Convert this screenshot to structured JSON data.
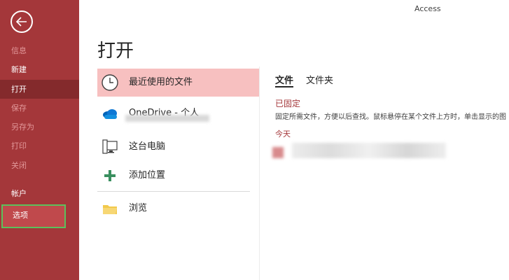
{
  "app": {
    "name": "Access"
  },
  "page": {
    "title": "打开"
  },
  "sidebar": {
    "items": [
      {
        "label": "信息",
        "state": "disabled"
      },
      {
        "label": "新建",
        "state": "normal"
      },
      {
        "label": "打开",
        "state": "active"
      },
      {
        "label": "保存",
        "state": "disabled"
      },
      {
        "label": "另存为",
        "state": "disabled"
      },
      {
        "label": "打印",
        "state": "disabled"
      },
      {
        "label": "关闭",
        "state": "disabled"
      },
      {
        "label": "帐户",
        "state": "normal"
      },
      {
        "label": "选项",
        "state": "highlighted"
      }
    ]
  },
  "locations": [
    {
      "label": "最近使用的文件",
      "icon": "clock-icon",
      "selected": true
    },
    {
      "label": "OneDrive - 个人",
      "icon": "onedrive-cloud-icon",
      "selected": false
    },
    {
      "label": "这台电脑",
      "icon": "this-pc-icon",
      "selected": false
    },
    {
      "label": "添加位置",
      "icon": "plus-icon",
      "selected": false
    },
    {
      "label": "浏览",
      "icon": "folder-icon",
      "selected": false
    }
  ],
  "recent": {
    "tabs": [
      {
        "label": "文件",
        "active": true
      },
      {
        "label": "文件夹",
        "active": false
      }
    ],
    "pinned_heading": "已固定",
    "pinned_description": "固定所需文件，方便以后查找。鼠标悬停在某个文件上方时，单击显示的图",
    "today_label": "今天"
  },
  "colors": {
    "sidebar": "#a4373a",
    "sidebar_active": "#842a2c",
    "selected_location": "#f7c0c0",
    "accent": "#a4373a",
    "options_highlight_border": "#5cc15c"
  }
}
